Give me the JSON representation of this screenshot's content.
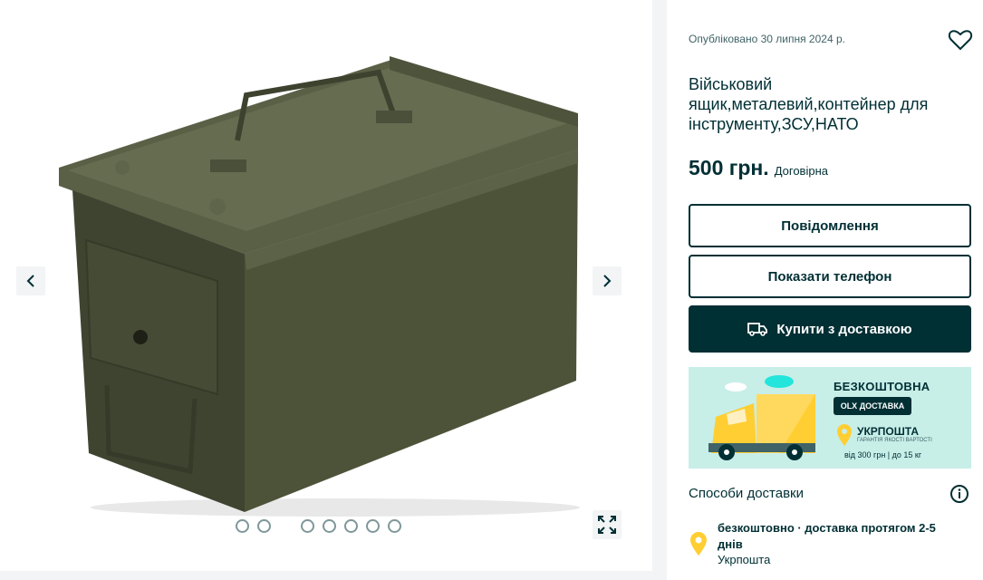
{
  "gallery": {
    "image_alt": "military ammo box",
    "photo_count": 7,
    "active_index": 1
  },
  "ad": {
    "posted": "Опубліковано 30 липня 2024 р.",
    "title": "Військовий ящик,металевий,контейнер для інструменту,ЗСУ,НАТО",
    "price": "500 грн.",
    "negotiable": "Договірна"
  },
  "actions": {
    "message": "Повідомлення",
    "phone": "Показати телефон",
    "buy": "Купити з доставкою"
  },
  "banner": {
    "free": "БЕЗКОШТОВНА",
    "olx": "OLX ДОСТАВКА",
    "carrier": "УКРПОШТА",
    "carrier_sub": "ГАРАНТІЯ ЯКОСТІ ВАРТОСТІ",
    "condition": "від 300 грн | до 15 кг"
  },
  "delivery": {
    "heading": "Способи доставки",
    "option": "безкоштовно · доставка протягом 2-5 днів",
    "carrier": "Укрпошта"
  },
  "colors": {
    "brand": "#002f34",
    "banner_bg": "#c8eee8",
    "truck": "#ffce32",
    "box": "#4b5139"
  }
}
